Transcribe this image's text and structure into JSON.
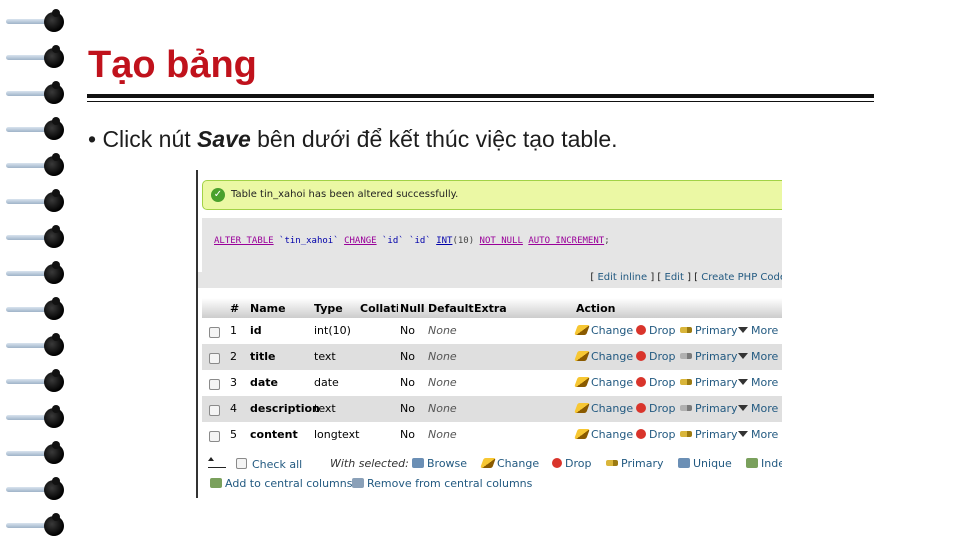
{
  "slide": {
    "title": "Tạo bảng",
    "bullet_prefix": "• Click nút ",
    "bullet_bold": "Save",
    "bullet_suffix": " bên dưới để kết thúc việc tạo table."
  },
  "screenshot": {
    "success_message": "Table tin_xahoi has been altered successfully.",
    "sql": {
      "k1": "ALTER TABLE",
      "t1": " `tin_xahoi` ",
      "k2": "CHANGE",
      "t2": " `id` `id` ",
      "k3": "INT",
      "t3": "(10) ",
      "k4": "NOT NULL",
      "t4": " ",
      "k5": "AUTO_INCREMENT",
      "t5": ";"
    },
    "links": {
      "open": "[ ",
      "edit_inline": "Edit inline",
      "sep1": " ] [ ",
      "edit": "Edit",
      "sep2": " ] [ ",
      "create": "Create PHP Code"
    },
    "columns": [
      "#",
      "Name",
      "Type",
      "Collation",
      "Null",
      "Default",
      "Extra",
      "Action"
    ],
    "rows": [
      {
        "num": "1",
        "name": "id",
        "type": "int(10)",
        "null": "No",
        "default": "None"
      },
      {
        "num": "2",
        "name": "title",
        "type": "text",
        "null": "No",
        "default": "None"
      },
      {
        "num": "3",
        "name": "date",
        "type": "date",
        "null": "No",
        "default": "None"
      },
      {
        "num": "4",
        "name": "description",
        "type": "text",
        "null": "No",
        "default": "None"
      },
      {
        "num": "5",
        "name": "content",
        "type": "longtext",
        "null": "No",
        "default": "None"
      }
    ],
    "actions": {
      "change": "Change",
      "drop": "Drop",
      "primary": "Primary",
      "more": "More"
    },
    "footer": {
      "check_all": "Check all",
      "with_selected": "With selected:",
      "browse": "Browse",
      "change": "Change",
      "drop": "Drop",
      "primary": "Primary",
      "unique": "Unique",
      "index": "Index",
      "add_central": "Add to central columns",
      "remove_central": "Remove from central columns"
    }
  }
}
